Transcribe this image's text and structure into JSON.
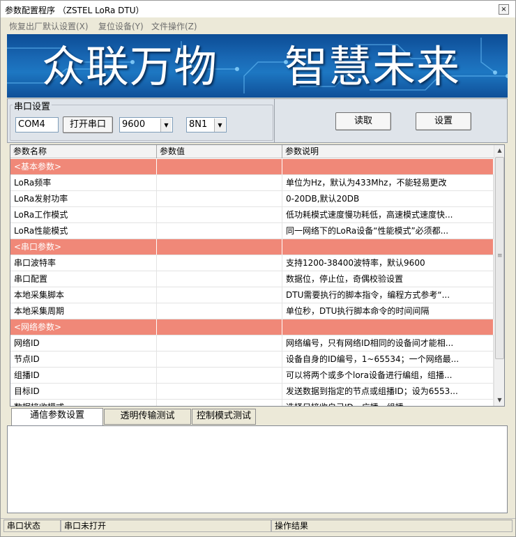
{
  "window": {
    "title": "参数配置程序 （ZSTEL LoRa DTU）",
    "close_glyph": "×"
  },
  "menu": [
    {
      "label": "恢复出厂默认设置(X)"
    },
    {
      "label": "复位设备(Y)"
    },
    {
      "label": "文件操作(Z)"
    }
  ],
  "banner": {
    "slogan_left": "众联万物",
    "slogan_right": "智慧未来"
  },
  "serial": {
    "group_label": "串口设置",
    "port": "COM4",
    "open_button": "打开串口",
    "baud": "9600",
    "format": "8N1",
    "read_button": "读取",
    "set_button": "设置"
  },
  "grid": {
    "headers": [
      "参数名称",
      "参数值",
      "参数说明"
    ],
    "rows": [
      {
        "type": "section",
        "name": "<基本参数>",
        "value": "",
        "desc": ""
      },
      {
        "type": "param",
        "name": "LoRa频率",
        "value": "",
        "desc": "单位为Hz，默认为433Mhz，不能轻易更改"
      },
      {
        "type": "param",
        "name": "LoRa发射功率",
        "value": "",
        "desc": "0-20DB,默认20DB"
      },
      {
        "type": "param",
        "name": "LoRa工作模式",
        "value": "",
        "desc": "低功耗模式速度慢功耗低，高速模式速度快..."
      },
      {
        "type": "param",
        "name": "LoRa性能模式",
        "value": "",
        "desc": "同一网络下的LoRa设备“性能模式”必须都..."
      },
      {
        "type": "section",
        "name": "<串口参数>",
        "value": "",
        "desc": ""
      },
      {
        "type": "param",
        "name": "串口波特率",
        "value": "",
        "desc": "支持1200-38400波特率，默认9600"
      },
      {
        "type": "param",
        "name": "串口配置",
        "value": "",
        "desc": "数据位，停止位，奇偶校验设置"
      },
      {
        "type": "param",
        "name": "本地采集脚本",
        "value": "",
        "desc": "DTU需要执行的脚本指令，编程方式参考“..."
      },
      {
        "type": "param",
        "name": "本地采集周期",
        "value": "",
        "desc": "单位秒，DTU执行脚本命令的时间间隔"
      },
      {
        "type": "section",
        "name": "<网络参数>",
        "value": "",
        "desc": ""
      },
      {
        "type": "param",
        "name": "网络ID",
        "value": "",
        "desc": "网络编号，只有网络ID相同的设备间才能相..."
      },
      {
        "type": "param",
        "name": "节点ID",
        "value": "",
        "desc": "设备自身的ID编号，1~65534；一个网络最..."
      },
      {
        "type": "param",
        "name": "组播ID",
        "value": "",
        "desc": "可以将两个或多个lora设备进行编组，组播..."
      },
      {
        "type": "param",
        "name": "目标ID",
        "value": "",
        "desc": "发送数据到指定的节点或组播ID；设为6553..."
      },
      {
        "type": "param",
        "name": "数据接收模式",
        "value": "",
        "desc": "选择只接收自己ID、广播、组播"
      }
    ],
    "scroll_position": 0.0
  },
  "tabs": [
    {
      "label": "通信参数设置",
      "active": true
    },
    {
      "label": "透明传输测试",
      "active": false
    },
    {
      "label": "控制模式测试",
      "active": false
    }
  ],
  "status": {
    "port_label": "串口状态",
    "port_state": "串口未打开",
    "result_label": "操作结果",
    "result_value": ""
  },
  "colors": {
    "section_row": "#f08878",
    "banner_dark": "#0c4c95",
    "banner_light": "#1d77c2"
  },
  "icons": {
    "dropdown": "▼",
    "scroll_up": "▲",
    "scroll_down": "▼",
    "scroll_grip": "≡"
  }
}
